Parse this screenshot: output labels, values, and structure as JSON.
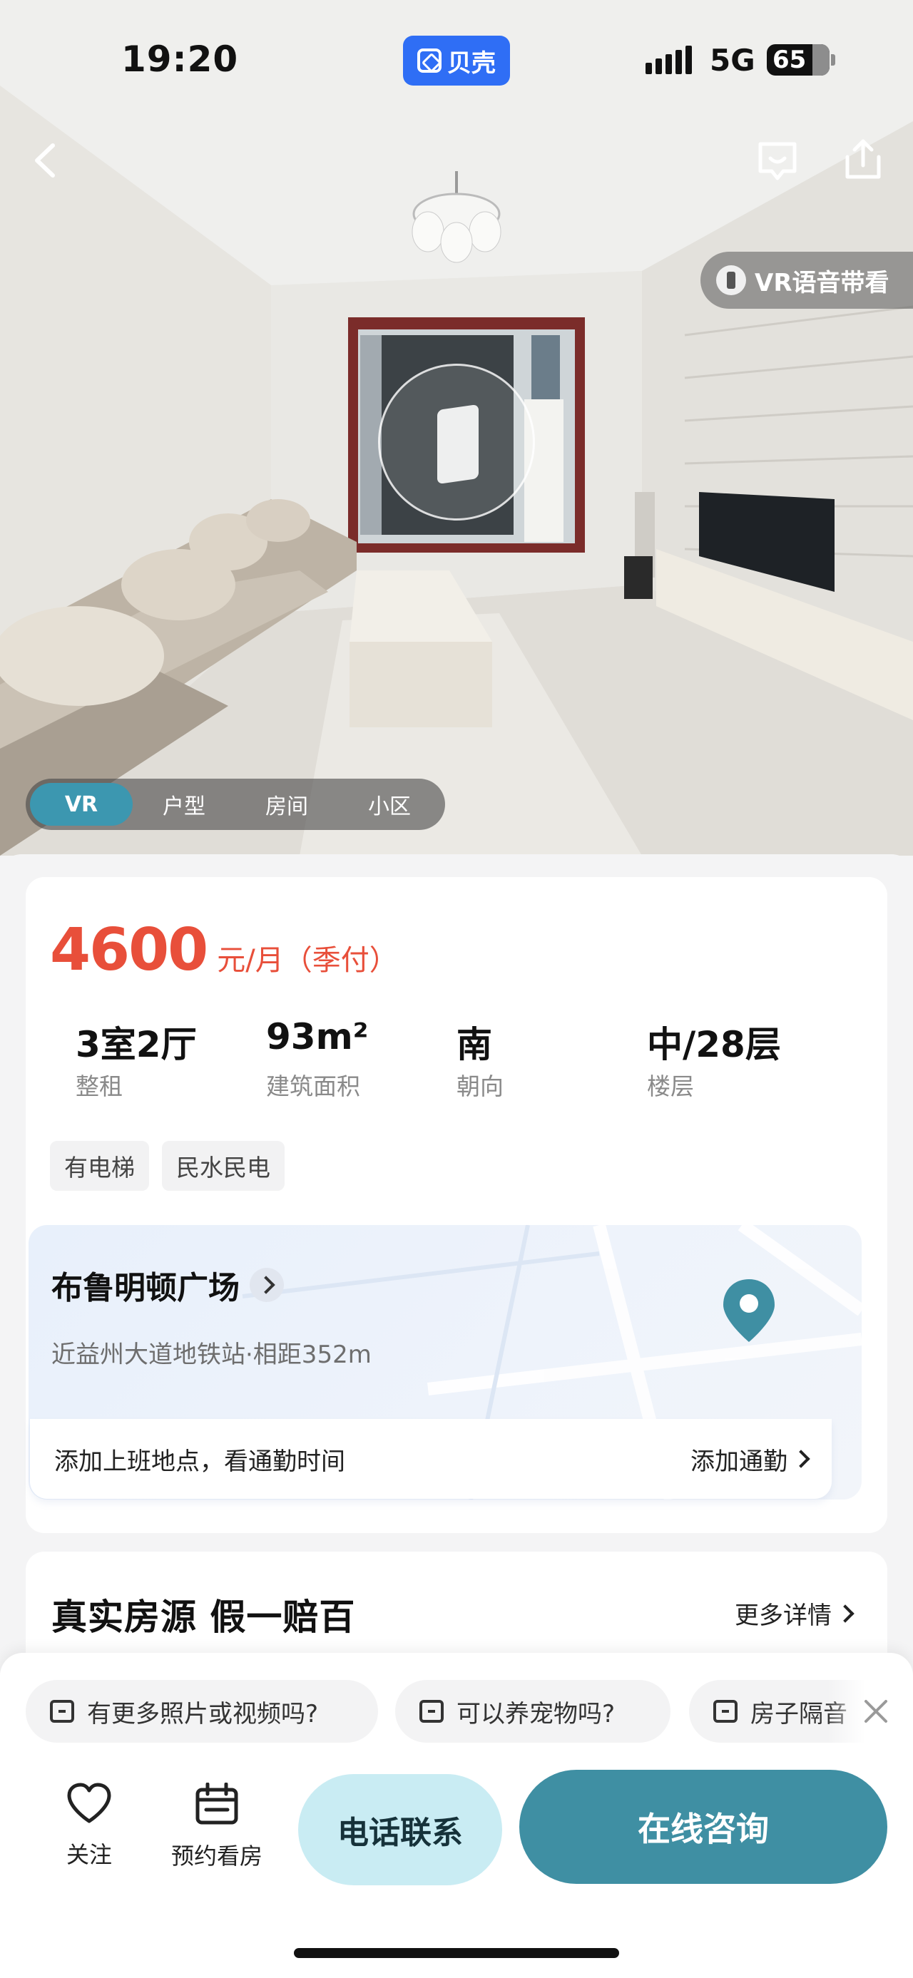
{
  "status_bar": {
    "time": "19:20",
    "brand": "贝壳",
    "network": "5G",
    "battery": "65"
  },
  "hero": {
    "vr_guide_label": "VR语音带看",
    "media_tabs": [
      {
        "label": "VR",
        "active": true
      },
      {
        "label": "户型",
        "active": false
      },
      {
        "label": "房间",
        "active": false
      },
      {
        "label": "小区",
        "active": false
      }
    ]
  },
  "listing": {
    "price": "4600",
    "price_unit": "元/月（季付）",
    "stats": [
      {
        "value": "3室2厅",
        "label": "整租"
      },
      {
        "value": "93m²",
        "label": "建筑面积"
      },
      {
        "value": "南",
        "label": "朝向"
      },
      {
        "value": "中/28层",
        "label": "楼层"
      }
    ],
    "tags": [
      "有电梯",
      "民水民电"
    ]
  },
  "location": {
    "community": "布鲁明顿广场",
    "subway": "近益州大道地铁站·相距352m",
    "commute_prompt": "添加上班地点，看通勤时间",
    "commute_action": "添加通勤"
  },
  "guarantee": {
    "title": "真实房源 假一赔百",
    "more": "更多详情"
  },
  "quick_questions": [
    "有更多照片或视频吗?",
    "可以养宠物吗?",
    "房子隔音"
  ],
  "actions": {
    "follow": "关注",
    "book": "预约看房",
    "call": "电话联系",
    "chat": "在线咨询"
  },
  "colors": {
    "price": "#e84f3a",
    "accent": "#3f8fa3",
    "call_bg": "#c9ecf3",
    "brand": "#2f6ef5"
  }
}
